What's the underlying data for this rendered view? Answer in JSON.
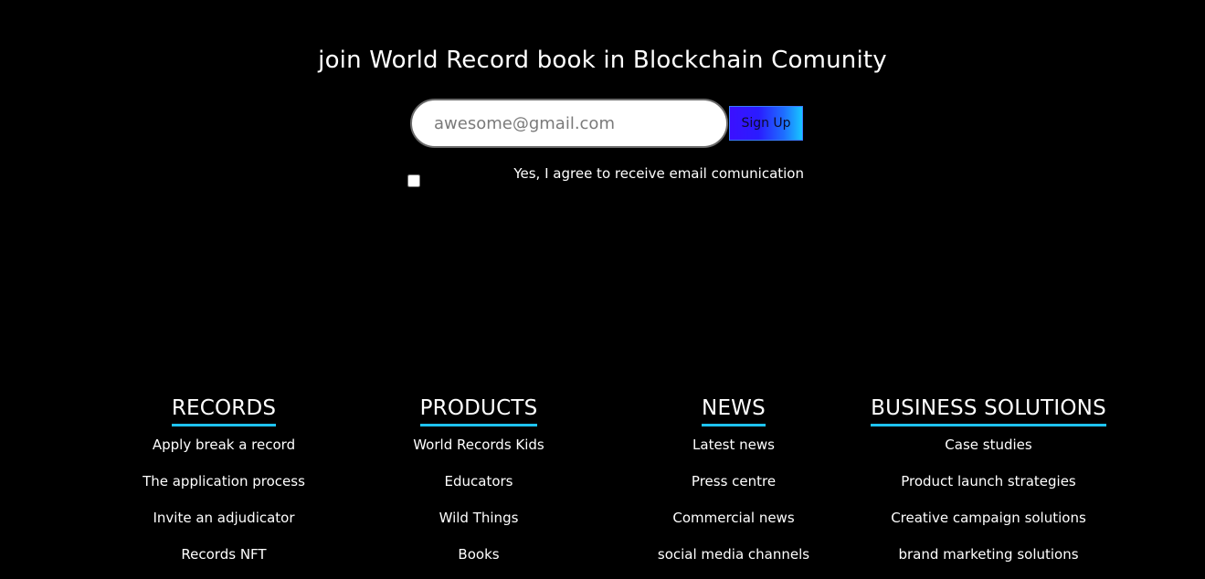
{
  "newsletter": {
    "title": "join World Record book in Blockchain Comunity",
    "email_placeholder": "awesome@gmail.com",
    "email_value": "",
    "signup_label": "Sign Up",
    "agree_label": "Yes, I agree to receive email comunication",
    "agree_checked": false
  },
  "footer": {
    "columns": [
      {
        "heading": "RECORDS",
        "links": [
          "Apply break a record",
          "The application process",
          "Invite an adjudicator",
          "Records NFT"
        ]
      },
      {
        "heading": "PRODUCTS",
        "links": [
          "World Records Kids",
          "Educators",
          "Wild Things",
          "Books"
        ]
      },
      {
        "heading": "NEWS",
        "links": [
          "Latest news",
          "Press centre",
          "Commercial news",
          "social media channels"
        ]
      },
      {
        "heading": "BUSINESS SOLUTIONS",
        "links": [
          "Case studies",
          "Product launch strategies",
          "Creative campaign solutions",
          "brand marketing solutions"
        ]
      }
    ]
  },
  "colors": {
    "background": "#000000",
    "accent_underline": "#1ec3f2",
    "button_gradient_start": "#3b10ff",
    "button_gradient_end": "#18c6ff"
  }
}
